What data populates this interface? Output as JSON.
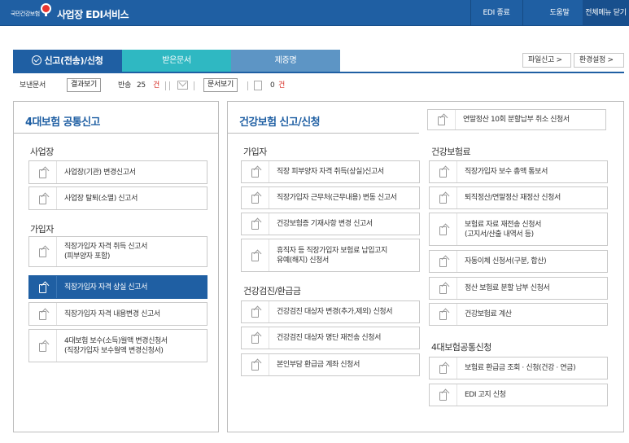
{
  "header": {
    "logo_text": "국민건강보험",
    "app_title": "사업장 EDI서비스",
    "edi_exit": "EDI 종료",
    "help": "도움말",
    "close_all": "전체메뉴 닫기"
  },
  "tabs": [
    {
      "label": "신고(전송)/신청"
    },
    {
      "label": "받은문서"
    },
    {
      "label": "제증명"
    }
  ],
  "toolbar": {
    "file_report": "파일신고 >",
    "env_settings": "환경설정 >"
  },
  "status": {
    "sent_docs": "보낸문서",
    "result_view": "결과보기",
    "returned": "반송",
    "returned_count": "25",
    "unit": "건",
    "doc_view": "문서보기",
    "doc_count": "0",
    "doc_unit": "건"
  },
  "left_panel": {
    "title": "4대보험 공통신고",
    "sections": {
      "workplace": "사업장",
      "subscriber": "가입자"
    },
    "workplace_items": [
      {
        "label": "사업장(기관) 변경신고서"
      },
      {
        "label": "사업장 탈퇴(소멸) 신고서"
      }
    ],
    "subscriber_items": [
      {
        "label": "직장가입자 자격 취득 신고서\n(피부양자 포함)"
      },
      {
        "label": "직장가입자 자격 상실 신고서"
      },
      {
        "label": "직장가입자 자격 내용변경 신고서"
      },
      {
        "label": "4대보험 보수(소득)월액 변경신청서\n(직장가입자 보수월액 변경신청서)"
      }
    ]
  },
  "right_panel": {
    "title": "건강보험 신고/신청",
    "top_item": "연말정산 10회 분할납부 취소 신청서",
    "sections": {
      "subscriber": "가입자",
      "checkup": "건강검진/환급금",
      "health": "건강보험료",
      "common": "4대보험공통신청"
    },
    "subscriber_items": [
      {
        "label": "직장 피부양자 자격 취득(상실)신고서"
      },
      {
        "label": "직장가입자 근무처(근무내용) 변동 신고서"
      },
      {
        "label": "건강보험증 기재사항 변경 신고서"
      },
      {
        "label": "휴직자 등 직장가입자 보험료 납입고지\n유예(해지) 신청서"
      }
    ],
    "checkup_items": [
      {
        "label": "건강검진 대상자 변경(추가,제외) 신청서"
      },
      {
        "label": "건강검진 대상자 명단 재전송 신청서"
      },
      {
        "label": "본인부담 환급금 계좌 신청서"
      }
    ],
    "health_items": [
      {
        "label": "직장가입자 보수 총액 통보서"
      },
      {
        "label": "퇴직정산/연말정산 재정산 신청서"
      },
      {
        "label": "보험료 자료 재전송 신청서\n(고지서/산출 내역서 등)"
      },
      {
        "label": "자동이체 신청서(구분, 합산)"
      },
      {
        "label": "정산 보험료 분할 납부 신청서"
      },
      {
        "label": "건강보험료 계산"
      }
    ],
    "common_items": [
      {
        "label": "보험료 환급금 조회 · 신청(건강 · 연금)"
      },
      {
        "label": "EDI 고지 신청"
      }
    ]
  },
  "colors": {
    "brand_blue": "#1f5fa3",
    "tab_teal": "#2fb8c2",
    "tab_lightblue": "#5d95c5",
    "alert_red": "#d6281f"
  }
}
